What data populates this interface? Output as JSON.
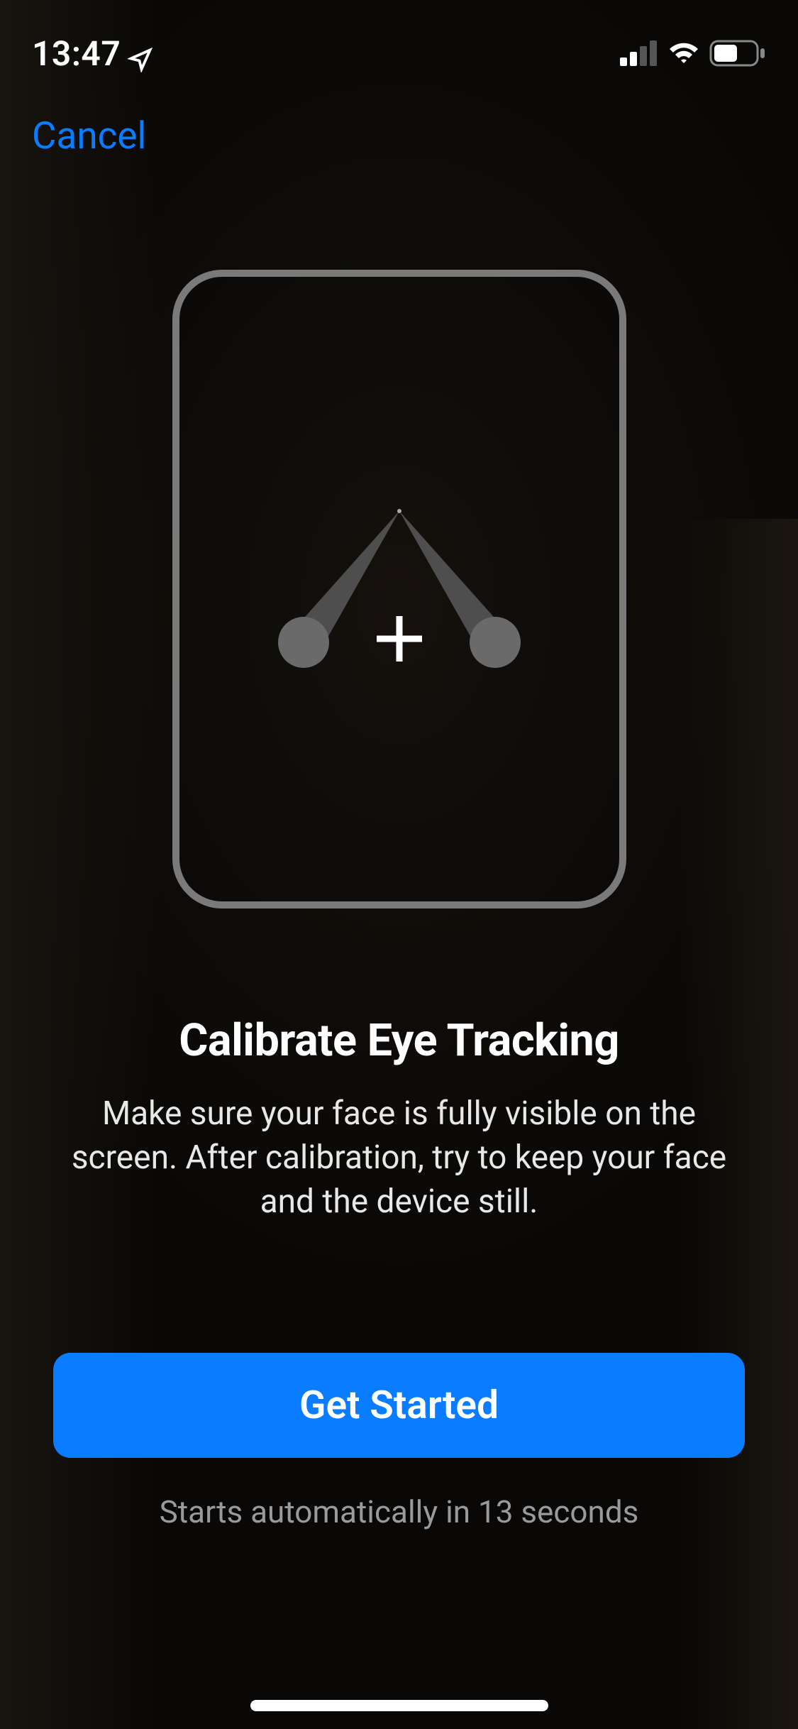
{
  "status_bar": {
    "time": "13:47"
  },
  "nav": {
    "cancel_label": "Cancel"
  },
  "content": {
    "title": "Calibrate Eye Tracking",
    "description": "Make sure your face is fully visible on the screen. After calibration, try to keep your face and the device still."
  },
  "actions": {
    "primary_label": "Get Started",
    "countdown_text": "Starts automatically in 13 seconds"
  }
}
